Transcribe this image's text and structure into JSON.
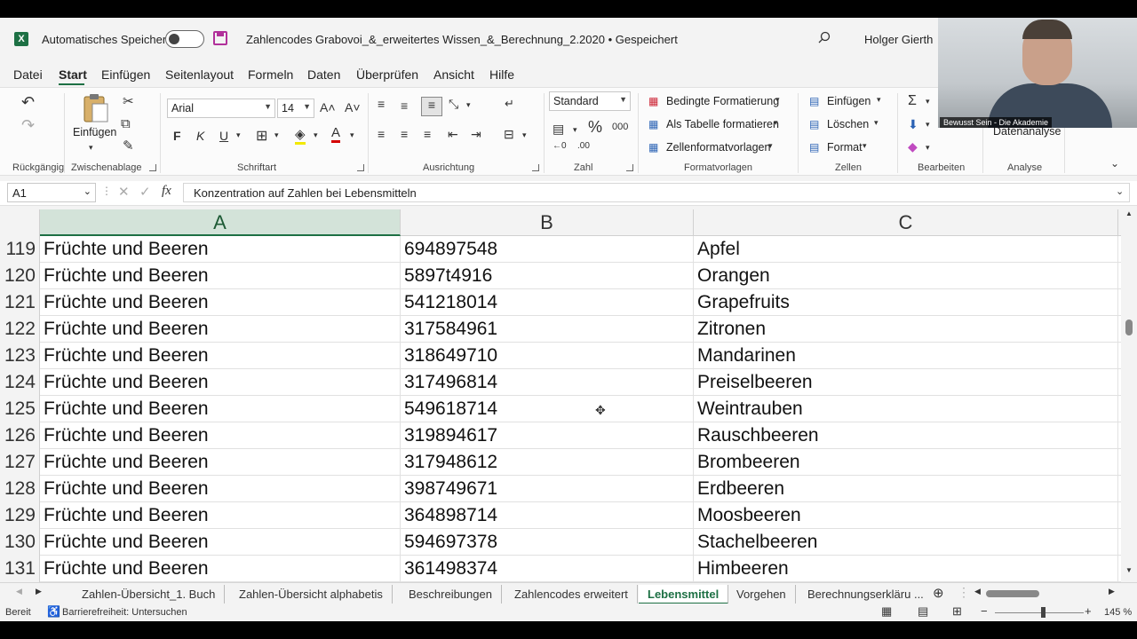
{
  "titlebar": {
    "autosave_label": "Automatisches Speichern",
    "document_title": "Zahlencodes Grabovoi_&_erweitertes Wissen_&_Berechnung_2.2020 • Gespeichert",
    "user": "Holger Gierth"
  },
  "menu": [
    "Datei",
    "Start",
    "Einfügen",
    "Seitenlayout",
    "Formeln",
    "Daten",
    "Überprüfen",
    "Ansicht",
    "Hilfe"
  ],
  "ribbon": {
    "groups": {
      "undo": "Rückgängig",
      "clipboard": "Zwischenablage",
      "font": "Schriftart",
      "alignment": "Ausrichtung",
      "number": "Zahl",
      "styles": "Formatvorlagen",
      "cells": "Zellen",
      "editing": "Bearbeiten",
      "analysis": "Analyse"
    },
    "paste_label": "Einfügen",
    "font_name": "Arial",
    "font_size": "14",
    "number_format": "Standard",
    "conditional": "Bedingte Formatierung",
    "as_table": "Als Tabelle formatieren",
    "cell_styles": "Zellenformatvorlagen",
    "insert": "Einfügen",
    "delete": "Löschen",
    "format": "Format",
    "data_analysis": "Datenanalyse",
    "bold": "F",
    "italic": "K",
    "underline": "U",
    "font_color": "A",
    "percent": "%",
    "thousands": "000"
  },
  "formula_bar": {
    "name_box": "A1",
    "fx": "fx",
    "content": "Konzentration auf Zahlen bei Lebensmitteln"
  },
  "grid": {
    "columns": [
      "A",
      "B",
      "C"
    ],
    "rows": [
      {
        "num": "119",
        "a": "Früchte und Beeren",
        "b": "694897548",
        "c": "Apfel"
      },
      {
        "num": "120",
        "a": "Früchte und Beeren",
        "b": "5897t4916",
        "c": "Orangen"
      },
      {
        "num": "121",
        "a": "Früchte und Beeren",
        "b": "541218014",
        "c": "Grapefruits"
      },
      {
        "num": "122",
        "a": "Früchte und Beeren",
        "b": "317584961",
        "c": "Zitronen"
      },
      {
        "num": "123",
        "a": "Früchte und Beeren",
        "b": "318649710",
        "c": "Mandarinen"
      },
      {
        "num": "124",
        "a": "Früchte und Beeren",
        "b": "317496814",
        "c": "Preiselbeeren"
      },
      {
        "num": "125",
        "a": "Früchte und Beeren",
        "b": "549618714",
        "c": "Weintrauben"
      },
      {
        "num": "126",
        "a": "Früchte und Beeren",
        "b": "319894617",
        "c": "Rauschbeeren"
      },
      {
        "num": "127",
        "a": "Früchte und Beeren",
        "b": "317948612",
        "c": "Brombeeren"
      },
      {
        "num": "128",
        "a": "Früchte und Beeren",
        "b": "398749671",
        "c": "Erdbeeren"
      },
      {
        "num": "129",
        "a": "Früchte und Beeren",
        "b": "364898714",
        "c": "Moosbeeren"
      },
      {
        "num": "130",
        "a": "Früchte und Beeren",
        "b": "594697378",
        "c": "Stachelbeeren"
      },
      {
        "num": "131",
        "a": "Früchte und Beeren",
        "b": "361498374",
        "c": "Himbeeren"
      }
    ]
  },
  "sheet_tabs": [
    "Zahlen-Übersicht_1. Buch",
    "Zahlen-Übersicht alphabetis",
    "Beschreibungen",
    "Zahlencodes erweitert",
    "Lebensmittel",
    "Vorgehen",
    "Berechnungserkläru ..."
  ],
  "active_sheet": "Lebensmittel",
  "status": {
    "ready": "Bereit",
    "accessibility": "Barrierefreiheit: Untersuchen",
    "zoom": "145 %"
  },
  "webcam_caption": "Bewusst Sein - Die Akademie",
  "colors": {
    "accent": "#1d7044",
    "save_icon": "#b1309a"
  }
}
